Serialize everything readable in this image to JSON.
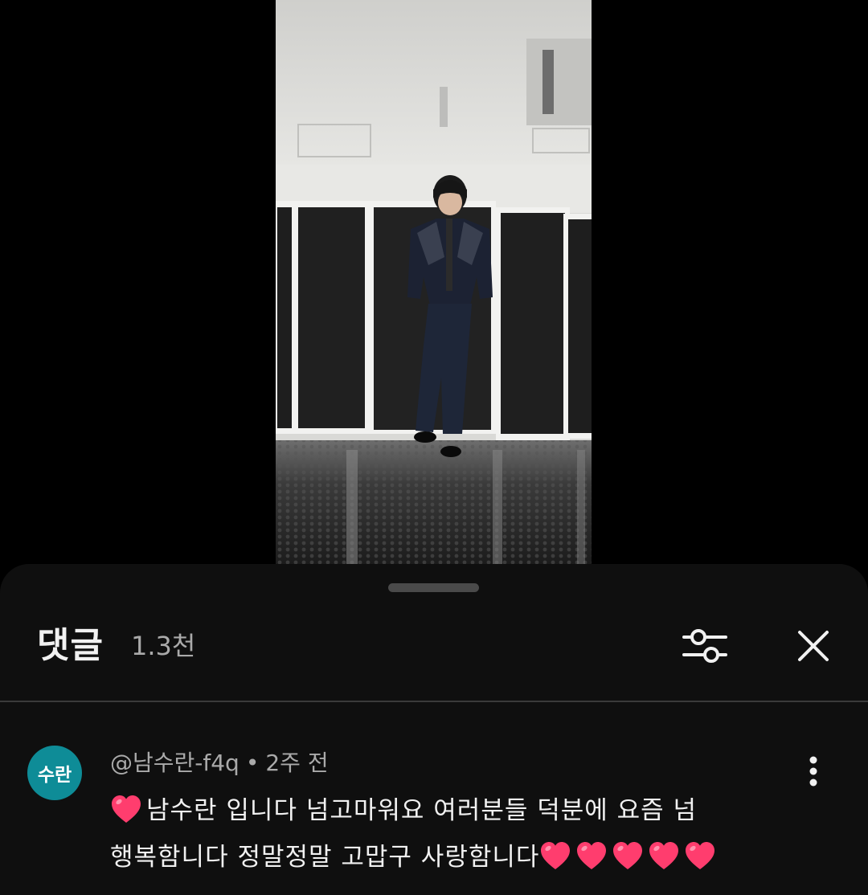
{
  "video": {
    "description_icon": "video-frame"
  },
  "comments_sheet": {
    "title": "댓글",
    "count": "1.3천",
    "filter_icon": "sliders-icon",
    "close_icon": "close-icon"
  },
  "comment": {
    "avatar_text": "수란",
    "avatar_color": "#0e8c97",
    "author": "@남수란-f4q",
    "separator": "•",
    "time": "2주 전",
    "line1_text": "남수란 입니다 넘고마워요 여러분들 덕분에 요즘 넘",
    "line2_text": "행복함니다 정말정말 고맙구 사랑함니다",
    "leading_hearts": 1,
    "trailing_hearts": 5,
    "heart_color": "#ff3d6e",
    "more_icon": "more-vert-icon"
  }
}
